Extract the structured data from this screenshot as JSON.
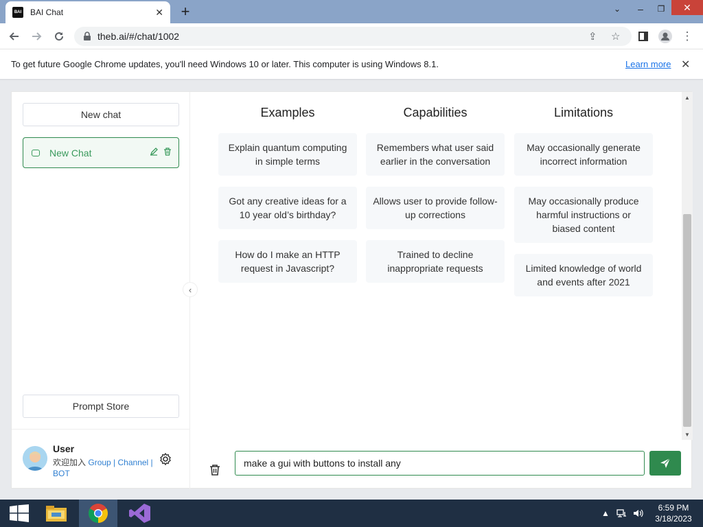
{
  "browser": {
    "tab_title": "BAI Chat",
    "favicon_text": "BAI",
    "url": "theb.ai/#/chat/1002",
    "infobar_text": "To get future Google Chrome updates, you'll need Windows 10 or later. This computer is using Windows 8.1.",
    "learn_more": "Learn more",
    "icons": [
      "back-icon",
      "forward-icon",
      "reload-icon",
      "lock-icon",
      "share-icon",
      "star-icon",
      "sidepanel-icon",
      "profile-icon",
      "menu-icon"
    ]
  },
  "sidebar": {
    "new_chat_button": "New chat",
    "chats": [
      {
        "title": "New Chat",
        "active": true
      }
    ],
    "prompt_store_button": "Prompt Store",
    "user": {
      "name": "User",
      "join_text": "欢迎加入",
      "group": "Group",
      "sep1": " | ",
      "channel": "Channel",
      "sep2": " |",
      "bot": "BOT"
    }
  },
  "main": {
    "columns": [
      {
        "title": "Examples",
        "items": [
          "Explain quantum computing in simple terms",
          "Got any creative ideas for a 10 year old’s birthday?",
          "How do I make an HTTP request in Javascript?"
        ]
      },
      {
        "title": "Capabilities",
        "items": [
          "Remembers what user said earlier in the conversation",
          "Allows user to provide follow-up corrections",
          "Trained to decline inappropriate requests"
        ]
      },
      {
        "title": "Limitations",
        "items": [
          "May occasionally generate incorrect information",
          "May occasionally produce harmful instructions or biased content",
          "Limited knowledge of world and events after 2021"
        ]
      }
    ],
    "input_value": "make a gui with buttons to install any"
  },
  "taskbar": {
    "apps": [
      "file-explorer",
      "chrome",
      "visual-studio"
    ],
    "time": "6:59 PM",
    "date": "3/18/2023"
  },
  "colors": {
    "accent": "#2f8a4e",
    "titlebar": "#8aa4c8",
    "taskbar": "#1f2f43"
  }
}
